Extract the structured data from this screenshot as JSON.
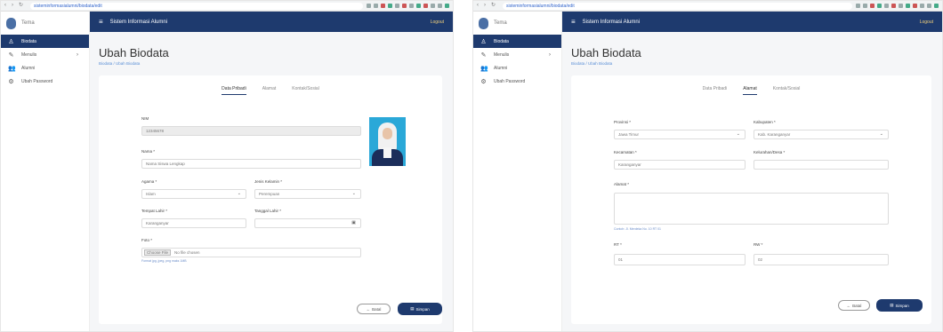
{
  "browser": {
    "url_left": "sisteminformasialumni/biodata/edit",
    "url_right": "sisteminformasialumni/biodata/edit"
  },
  "app": {
    "brand": "Tema",
    "topbar_title": "Sistem Informasi Alumni",
    "logout": "Logout"
  },
  "sidebar": {
    "items": [
      {
        "label": "Biodata",
        "icon": "user-icon"
      },
      {
        "label": "Menulis",
        "icon": "pen-icon"
      },
      {
        "label": "Alumni",
        "icon": "users-icon"
      },
      {
        "label": "Ubah Password",
        "icon": "gear-icon"
      }
    ]
  },
  "page": {
    "title": "Ubah Biodata",
    "breadcrumb": "Biodata / Ubah Biodata"
  },
  "tabs": [
    "Data Pribadi",
    "Alamat",
    "Kontak/Sosial"
  ],
  "left_form": {
    "nim_label": "NIM",
    "nim_value": "12345678",
    "nama_label": "Nama *",
    "nama_value": "Nama Siswa Lengkap",
    "agama_label": "Agama *",
    "agama_value": "Islam",
    "jk_label": "Jenis Kelamin *",
    "jk_value": "Perempuan",
    "tempat_label": "Tempat Lahir *",
    "tempat_value": "Karanganyar",
    "tanggal_label": "Tanggal Lahir *",
    "tanggal_value": "",
    "foto_label": "Foto *",
    "foto_button": "Choose File",
    "foto_status": "No file chosen",
    "foto_hint": "Format jpg, jpeg, png maks 1MB"
  },
  "right_form": {
    "provinsi_label": "Provinsi *",
    "provinsi_value": "Jawa Timur",
    "kabupaten_label": "Kabupaten *",
    "kabupaten_value": "Kab. Karanganyar",
    "kecamatan_label": "Kecamatan *",
    "kecamatan_value": "Karanganyar",
    "kelurahan_label": "Kelurahan/Desa *",
    "kelurahan_value": "",
    "alamat_label": "Alamat *",
    "alamat_value": "",
    "alamat_hint": "Contoh: Jl. Merdeka No. 10 RT 01",
    "rt_label": "RT *",
    "rt_value": "01",
    "rw_label": "RW *",
    "rw_value": "02"
  },
  "buttons": {
    "back": "Batal",
    "save": "Simpan"
  }
}
